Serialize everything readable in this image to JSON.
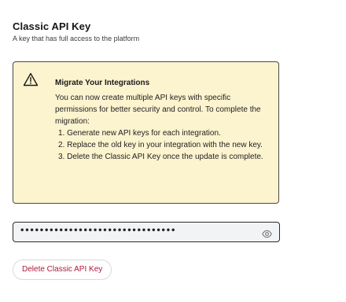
{
  "section": {
    "title": "Classic API Key",
    "subtitle": "A key that has full access to the platform"
  },
  "warning": {
    "icon": "warning-triangle-icon",
    "heading": "Migrate Your Integrations",
    "body": "You can now create multiple API keys with specific permissions for better security and control. To complete the migration:",
    "steps": [
      "1. Generate new API keys for each integration.",
      "2. Replace the old key in your integration with the new key.",
      "3. Delete the Classic API Key once the update is complete."
    ],
    "background_color": "#fcf3cf"
  },
  "key_field": {
    "masked_value": "••••••••••••••••••••••••••••••••",
    "toggle_icon": "eye-icon"
  },
  "actions": {
    "delete_label": "Delete Classic API Key",
    "delete_color": "#b0183a"
  }
}
